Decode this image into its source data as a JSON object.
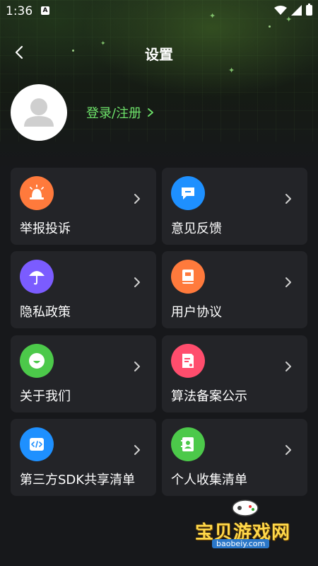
{
  "status_bar": {
    "time": "1:36",
    "a_badge": "A"
  },
  "header": {
    "title": "设置",
    "back_icon": "chevron-left-icon"
  },
  "profile": {
    "login_label": "登录/注册",
    "avatar_icon": "user-silhouette-icon"
  },
  "colors": {
    "accent_green": "#6ee26a",
    "card_bg": "#232428",
    "page_bg": "#17181b"
  },
  "menu": [
    {
      "label": "举报投诉",
      "icon": "alarm-siren-icon",
      "color": "#ff7a3c"
    },
    {
      "label": "意见反馈",
      "icon": "chat-bubble-icon",
      "color": "#1e90ff"
    },
    {
      "label": "隐私政策",
      "icon": "umbrella-icon",
      "color": "#7b5cff"
    },
    {
      "label": "用户协议",
      "icon": "book-icon",
      "color": "#ff7a3c"
    },
    {
      "label": "关于我们",
      "icon": "smiley-icon",
      "color": "#4cc94a"
    },
    {
      "label": "算法备案公示",
      "icon": "document-icon",
      "color": "#ff4d6d"
    },
    {
      "label": "第三方SDK共享清单",
      "icon": "code-icon",
      "color": "#1e90ff"
    },
    {
      "label": "个人收集清单",
      "icon": "contact-book-icon",
      "color": "#4cc94a"
    }
  ],
  "watermark": {
    "title": "宝贝游戏网",
    "url": "baobeiy.com"
  }
}
